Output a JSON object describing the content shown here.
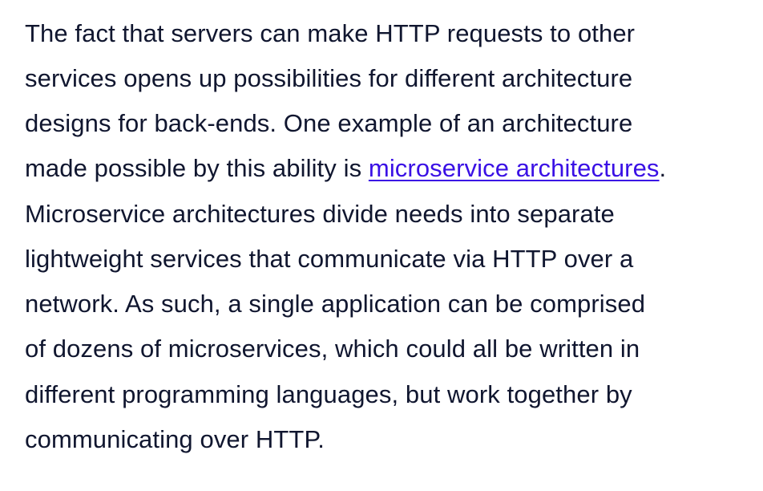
{
  "paragraph": {
    "line1": "The fact that servers can make HTTP requests to other",
    "line2": "services opens up possibilities for different architecture",
    "line3": "designs for back-ends. One example of an architecture",
    "line4_before": "made possible by this ability is ",
    "link_text": "microservice architectures",
    "line4_after": ".",
    "line5": "Microservice architectures divide needs into separate",
    "line6": "lightweight services that communicate via HTTP over a",
    "line7": "network. As such, a single application can be comprised",
    "line8": "of dozens of microservices, which could all be written in",
    "line9": "different programming languages, but work together by",
    "line10": "communicating over HTTP."
  },
  "colors": {
    "text": "#10162f",
    "link": "#3a10e5",
    "background": "#ffffff"
  }
}
